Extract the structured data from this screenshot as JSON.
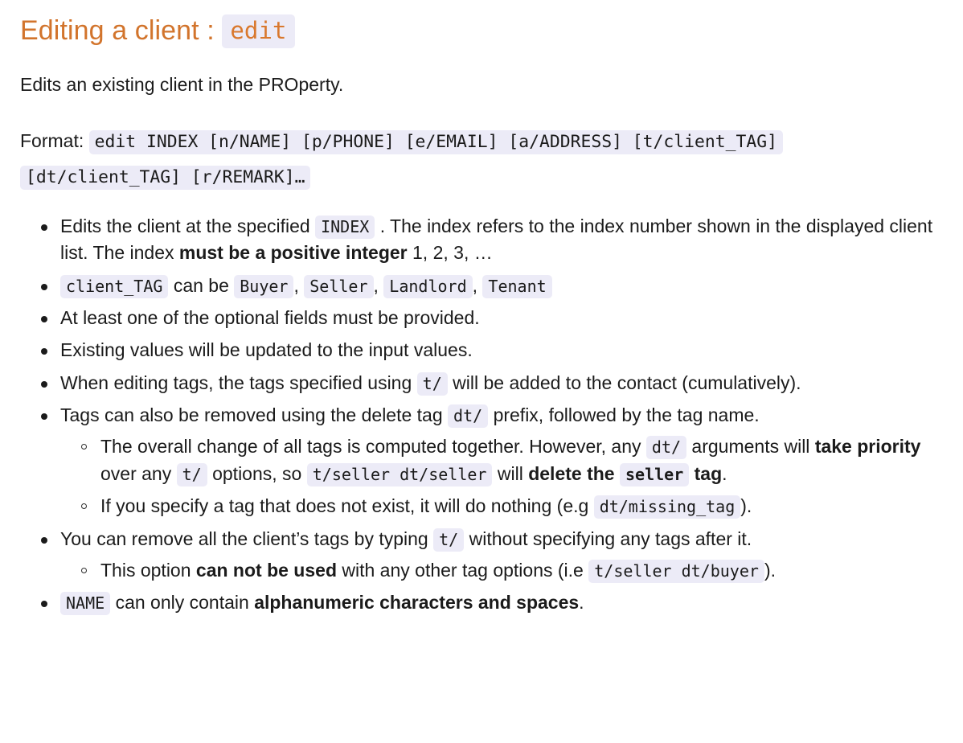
{
  "heading": {
    "text": "Editing a client :",
    "command": "edit"
  },
  "intro": "Edits an existing client in the PROperty.",
  "format": {
    "label": "Format:",
    "line1": "edit INDEX [n/NAME] [p/PHONE] [e/EMAIL] [a/ADDRESS] [t/client_TAG]",
    "line2": "[dt/client_TAG] [r/REMARK]…"
  },
  "bullets": {
    "b1": {
      "t1": "Edits the client at the specified",
      "c1": "INDEX",
      "t2": ". The index refers to the index number shown in the displayed client list. The index",
      "bold": "must be a positive integer",
      "t3": "1, 2, 3, …"
    },
    "b2": {
      "c1": "client_TAG",
      "t1": "can be",
      "c2": "Buyer",
      "sep1": ",",
      "c3": "Seller",
      "sep2": ",",
      "c4": "Landlord",
      "sep3": ",",
      "c5": "Tenant"
    },
    "b3": "At least one of the optional fields must be provided.",
    "b4": "Existing values will be updated to the input values.",
    "b5": {
      "t1": "When editing tags, the tags specified using",
      "c1": "t/",
      "t2": "will be added to the contact (cumulatively)."
    },
    "b6": {
      "t1": "Tags can also be removed using the delete tag",
      "c1": "dt/",
      "t2": "prefix, followed by the tag name.",
      "sub1": {
        "t1": "The overall change of all tags is computed together. However, any",
        "c1": "dt/",
        "t2": "arguments will",
        "bold1": "take priority",
        "t3": "over any",
        "c2": "t/",
        "t4": "options, so",
        "c3": "t/seller dt/seller",
        "t5": "will",
        "bold2": "delete the",
        "c4": "seller",
        "bold3": "tag",
        "t6": "."
      },
      "sub2": {
        "t1": "If you specify a tag that does not exist, it will do nothing (e.g",
        "c1": "dt/missing_tag",
        "t2": ")."
      }
    },
    "b7": {
      "t1": "You can remove all the client’s tags by typing",
      "c1": "t/",
      "t2": "without specifying any tags after it.",
      "sub1": {
        "t1": "This option",
        "bold": "can not be used",
        "t2": "with any other tag options (i.e",
        "c1": "t/seller dt/buyer",
        "t3": ")."
      }
    },
    "b8": {
      "c1": "NAME",
      "t1": "can only contain",
      "bold": "alphanumeric characters and spaces",
      "t2": "."
    }
  },
  "colors": {
    "heading_orange": "#d2742c",
    "code_bg": "#ecebf7",
    "text": "#1b1b1b"
  }
}
